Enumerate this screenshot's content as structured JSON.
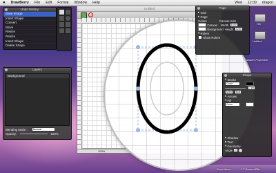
{
  "menubar": {
    "apple": "",
    "app_name": "DrawBerry",
    "menus": [
      "File",
      "Edit",
      "Format",
      "Window",
      "Help"
    ],
    "right": [
      "Wed",
      "12:09",
      "dragon"
    ]
  },
  "undo_panel": {
    "title": "Undo History",
    "items": [
      "Base Image",
      "Insert Shape",
      "Convert",
      "Move",
      "Resize",
      "Resize",
      "Insert Shape",
      "Delete Shape"
    ],
    "selected_index": 0
  },
  "layers_panel": {
    "title": "Layers",
    "layer_name": "Background",
    "blending_label": "Blending Mode :",
    "blending_value": "Normal",
    "opacity_label": "Opacity :",
    "opacity_value": "100%"
  },
  "document": {
    "title": "Untitled",
    "status": "100%"
  },
  "page_panel": {
    "title": "Page",
    "sections": [
      "Grid",
      "Page"
    ],
    "colors_label": "Colors",
    "canvas_size_label": "Canvas Size",
    "canvas_label": "Canvas",
    "background_label": "Background",
    "width_label": "Width",
    "height_label": "Height",
    "width_value": "1600",
    "height_value": "1200",
    "rulers_label": "Rulers",
    "show_rulers_label": "Show Rulers"
  },
  "shape_panel": {
    "title": "Shape",
    "stroke_label": "Stroke",
    "stroke_type": "Color",
    "stroke_width": "7 px",
    "miter_label": "Miter",
    "butt_label": "Butt",
    "arrows_label": "Arrows",
    "fill_label": "Fill",
    "fill_type": "Color",
    "shadow_label": "Shadow",
    "text_label": "Text",
    "geometry_label": "Geometry",
    "angle_label": "Angle",
    "angle_value": "0"
  },
  "desktop": {
    "drives": [
      "HD",
      "Untitled"
    ],
    "magnifier_label": "Master Projected!",
    "dock_labels": [
      "Docs Menu",
      "LT Ground Ellis"
    ]
  },
  "colors": {
    "selection_blue": "#3b62c9",
    "panel_bg": "#1e1e1e"
  }
}
